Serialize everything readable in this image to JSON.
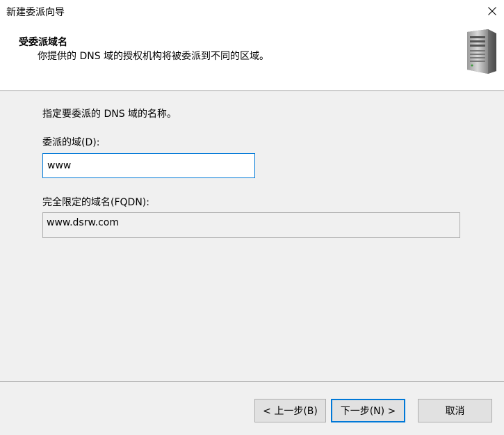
{
  "window": {
    "title": "新建委派向导"
  },
  "header": {
    "title": "受委派域名",
    "subtitle": "你提供的 DNS 域的授权机构将被委派到不同的区域。",
    "icon": "server-icon"
  },
  "body": {
    "instruction": "指定要委派的 DNS 域的名称。",
    "delegated_domain_label": "委派的域(D):",
    "delegated_domain_value": "www",
    "fqdn_label": "完全限定的域名(FQDN):",
    "fqdn_value": "www.dsrw.com"
  },
  "footer": {
    "back_label": "< 上一步(B)",
    "next_label": "下一步(N) >",
    "cancel_label": "取消"
  },
  "colors": {
    "accent": "#0078d7",
    "panel_bg": "#f0f0f0",
    "button_bg": "#e1e1e1"
  }
}
